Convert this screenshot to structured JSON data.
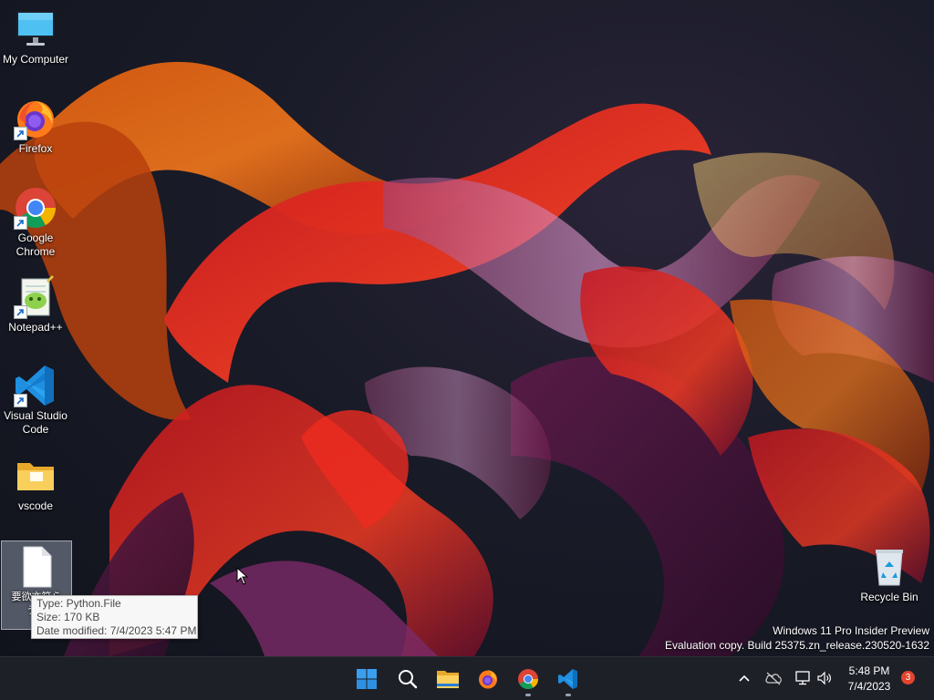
{
  "desktop": {
    "icons": [
      {
        "label": "My Computer",
        "icon": "monitor-icon"
      },
      {
        "label": "Firefox",
        "icon": "firefox-icon"
      },
      {
        "label": "Google Chrome",
        "icon": "chrome-icon"
      },
      {
        "label": "Notepad++",
        "icon": "notepadpp-icon"
      },
      {
        "label": "Visual Studio Code",
        "icon": "vscode-icon"
      },
      {
        "label": "vscode",
        "icon": "folder-icon"
      },
      {
        "label": "要欲亦符らう…",
        "icon": "file-icon"
      },
      {
        "label": "Recycle Bin",
        "icon": "recycle-bin-icon"
      }
    ],
    "tooltip": {
      "type": "Type: Python.File",
      "size": "Size: 170 KB",
      "date": "Date modified: 7/4/2023 5:47 PM"
    },
    "watermark": {
      "line1": "Windows 11 Pro Insider Preview",
      "line2": "Evaluation copy. Build 25375.zn_release.230520-1632"
    }
  },
  "taskbar": {
    "items": [
      {
        "name": "start",
        "icon": "windows-logo-icon"
      },
      {
        "name": "search",
        "icon": "search-icon"
      },
      {
        "name": "file-explorer",
        "icon": "folder-icon"
      },
      {
        "name": "firefox",
        "icon": "firefox-icon"
      },
      {
        "name": "chrome",
        "icon": "chrome-icon",
        "running": true
      },
      {
        "name": "vscode",
        "icon": "vscode-icon",
        "running": true
      }
    ],
    "tray": {
      "icons": [
        "chevron-up-icon",
        "cloud-off-icon",
        "network-icon",
        "speaker-icon"
      ],
      "time": "5:48 PM",
      "date": "7/4/2023",
      "notification_count": "3"
    }
  },
  "colors": {
    "taskbar_bg": "#1e2028",
    "desktop_bg": "#141722",
    "notification": "#e3442e",
    "vscode_blue": "#1f8fe0"
  }
}
